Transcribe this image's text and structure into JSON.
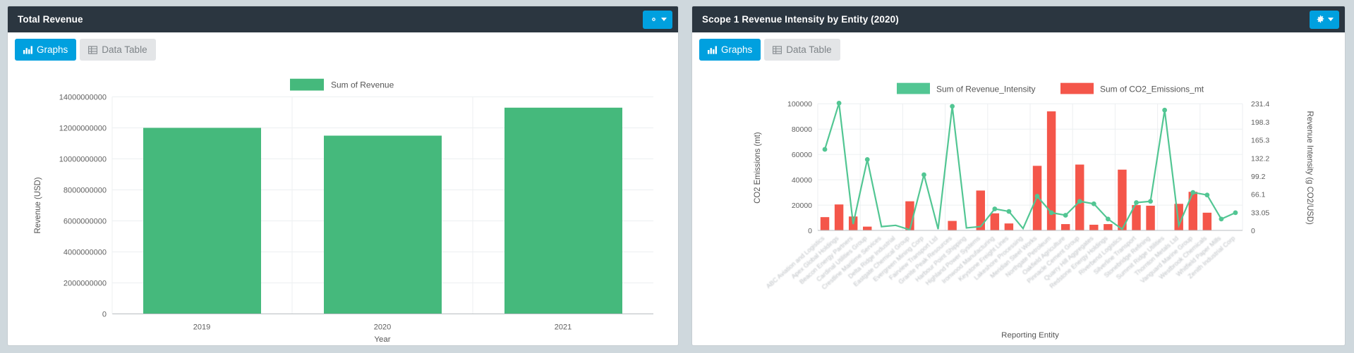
{
  "left_panel": {
    "title": "Total Revenue",
    "gear_icon": "gear-icon",
    "caret_icon": "chevron-down-icon",
    "tabs": [
      {
        "label": "Graphs",
        "icon": "bar-chart-icon",
        "active": true
      },
      {
        "label": "Data Table",
        "icon": "table-icon",
        "active": false
      }
    ]
  },
  "right_panel": {
    "title": "Scope 1 Revenue Intensity by Entity (2020)",
    "gear_icon": "gear-icon",
    "caret_icon": "chevron-down-icon",
    "tabs": [
      {
        "label": "Graphs",
        "icon": "bar-chart-icon",
        "active": true
      },
      {
        "label": "Data Table",
        "icon": "table-icon",
        "active": false
      }
    ]
  },
  "colors": {
    "accent": "#00a0df",
    "header_bg": "#2b3640",
    "bar_green": "#45b97c",
    "line_green": "#52c693",
    "bar_red": "#f4564a",
    "page_bg": "#cfd8dd"
  },
  "chart_data": [
    {
      "type": "bar",
      "title": "Total Revenue",
      "categories": [
        "2019",
        "2020",
        "2021"
      ],
      "series": [
        {
          "name": "Sum of Revenue",
          "color": "#45b97c",
          "values": [
            12000000000,
            11500000000,
            13300000000
          ]
        }
      ],
      "xlabel": "Year",
      "ylabel": "Revenue (USD)",
      "ylim": [
        0,
        14000000000
      ],
      "yticks": [
        0,
        2000000000,
        4000000000,
        6000000000,
        8000000000,
        10000000000,
        12000000000,
        14000000000
      ],
      "ytick_labels": [
        "0",
        "2000000000",
        "4000000000",
        "6000000000",
        "8000000000",
        "10000000000",
        "12000000000",
        "14000000000"
      ],
      "legend": [
        "Sum of Revenue"
      ],
      "legend_position": "top-center",
      "grid": true
    },
    {
      "type": "line",
      "title": "Scope 1 Revenue Intensity by Entity (2020)",
      "xlabel": "Reporting Entity",
      "ylabel": "CO2 Emissions (mt)",
      "y2label": "Revenue Intensity (g CO2/USD)",
      "ylim": [
        0,
        100000
      ],
      "yticks": [
        0,
        20000,
        40000,
        60000,
        80000,
        100000
      ],
      "ytick_labels": [
        "0",
        "20000",
        "40000",
        "60000",
        "80000",
        "100000"
      ],
      "y2lim": [
        0,
        231.4
      ],
      "y2tick_labels": [
        "0",
        "33.05",
        "66.1",
        "99.2",
        "132.2",
        "165.3",
        "198.3",
        "231.4"
      ],
      "grid": true,
      "legend_position": "top-center",
      "categories": [
        "ABC Aviation and Logistics",
        "Apex Global Holdings",
        "Beacon Energy Partners",
        "Cardinal Utilities Group",
        "Crestline Maritime Services",
        "Delta Ridge Industrial",
        "Eastgate Chemical Group",
        "Evergreen Mining Corp",
        "Fairview Transport Ltd",
        "Granite Peak Resources",
        "Harbour Point Shipping",
        "Highland Power Systems",
        "Ironwood Manufacturing",
        "Keystone Freight Lines",
        "Lakeshore Processing",
        "Meridian Steel Works",
        "Northgate Petroleum",
        "Oakfield Agriculture",
        "Pinnacle Cement Group",
        "Quarry Hill Aggregates",
        "Redstone Energy Holdings",
        "Riverbend Logistics",
        "Silverline Transport",
        "Stonebridge Refining",
        "Summit Ridge Utilities",
        "Thornton Metals Ltd",
        "Vanguard Marine Group",
        "Westbrook Chemicals",
        "Whitfield Paper Mills",
        "Zenith Industrial Corp"
      ],
      "series": [
        {
          "name": "Sum of CO2_Emissions_mt",
          "type": "bar",
          "axis": "left",
          "color": "#f4564a",
          "values": [
            10500,
            20500,
            11000,
            3000,
            0,
            0,
            23000,
            0,
            0,
            7500,
            0,
            31500,
            13500,
            5500,
            0,
            51000,
            94000,
            5000,
            52000,
            4500,
            5000,
            48000,
            20000,
            19500,
            0,
            21000,
            30500,
            14000,
            0,
            0
          ]
        },
        {
          "name": "Sum of Revenue_Intensity",
          "type": "line",
          "axis": "right",
          "color": "#52c693",
          "values": [
            64000,
            100500,
            5000,
            56000,
            3000,
            4000,
            500,
            44000,
            1000,
            98000,
            2000,
            3000,
            17000,
            15000,
            1500,
            27000,
            14000,
            12000,
            23000,
            21000,
            9000,
            1000,
            22000,
            23000,
            95000,
            4000,
            30000,
            28000,
            9000,
            14000
          ]
        }
      ]
    }
  ]
}
